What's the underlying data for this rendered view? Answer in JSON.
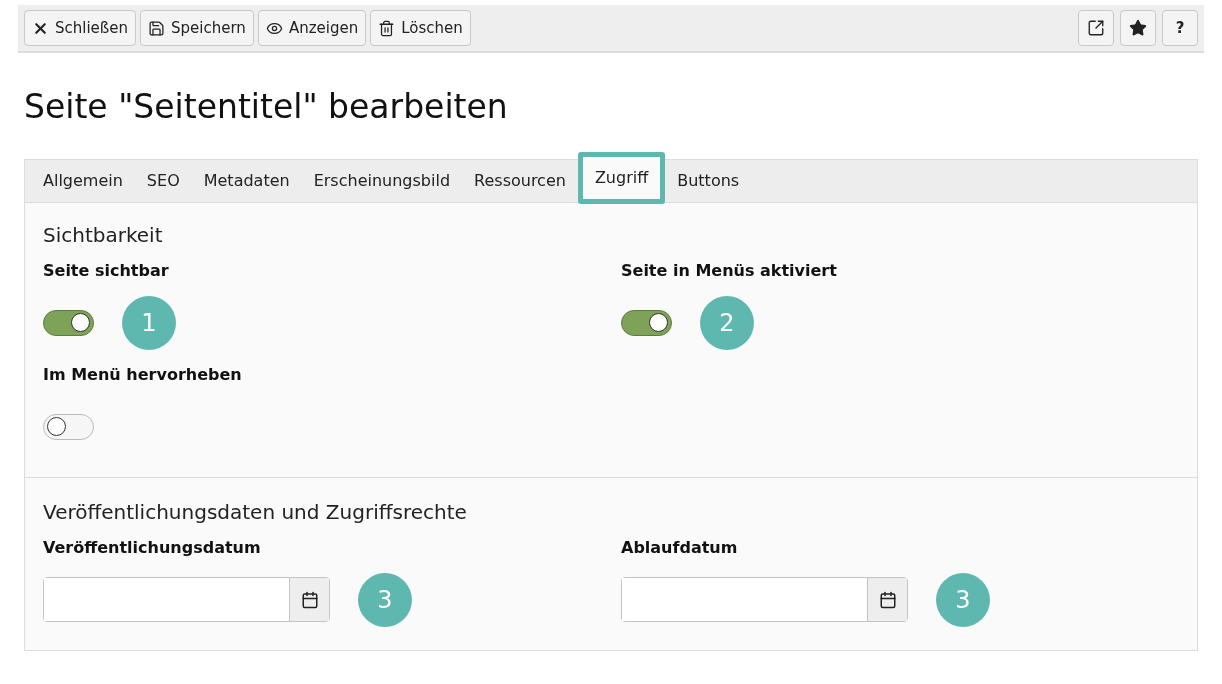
{
  "toolbar": {
    "left": [
      {
        "kind": "close",
        "label": "Schließen"
      },
      {
        "kind": "save",
        "label": "Speichern"
      },
      {
        "kind": "view",
        "label": "Anzeigen"
      },
      {
        "kind": "delete",
        "label": "Löschen"
      }
    ],
    "right": [
      {
        "kind": "external"
      },
      {
        "kind": "star"
      },
      {
        "kind": "text",
        "label": "?"
      }
    ]
  },
  "title": "Seite \"Seitentitel\" bearbeiten",
  "tabs": [
    {
      "label": "Allgemein",
      "selected": false,
      "highlighted": false
    },
    {
      "label": "SEO",
      "selected": false,
      "highlighted": false
    },
    {
      "label": "Metadaten",
      "selected": false,
      "highlighted": false
    },
    {
      "label": "Erscheinungsbild",
      "selected": false,
      "highlighted": false
    },
    {
      "label": "Ressourcen",
      "selected": false,
      "highlighted": false
    },
    {
      "label": "Zugriff",
      "selected": true,
      "highlighted": true
    },
    {
      "label": "Buttons",
      "selected": false,
      "highlighted": false
    }
  ],
  "sections": [
    {
      "title": "Sichtbarkeit",
      "fields": [
        {
          "kind": "toggle",
          "label": "Seite sichtbar",
          "on": true,
          "badge": "1"
        },
        {
          "kind": "toggle",
          "label": "Seite in Menüs aktiviert",
          "on": true,
          "badge": "2"
        },
        {
          "kind": "toggle",
          "label": "Im Menü hervorheben",
          "on": false
        }
      ]
    },
    {
      "title": "Veröffentlichungsdaten und Zugriffsrechte",
      "fields": [
        {
          "kind": "date",
          "label": "Veröffentlichungsdatum",
          "badge": "3"
        },
        {
          "kind": "date",
          "label": "Ablaufdatum",
          "badge": "3"
        }
      ]
    }
  ]
}
